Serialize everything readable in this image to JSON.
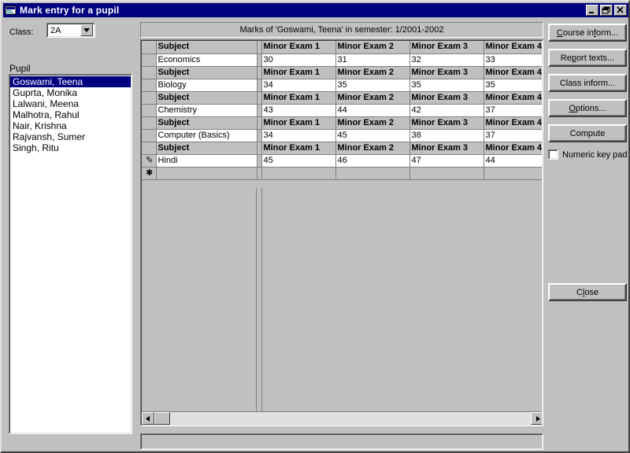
{
  "window": {
    "title": "Mark entry for a pupil",
    "icon": "app-window-icon",
    "minimize_label": "_",
    "restore_label": "❐",
    "close_label": "✕"
  },
  "left_panel": {
    "class_label": "Class:",
    "class_value": "2A",
    "pupil_label": "Pupil",
    "pupils": [
      {
        "name": "Goswami, Teena",
        "selected": true
      },
      {
        "name": "Guprta, Monika",
        "selected": false
      },
      {
        "name": "Lalwani, Meena",
        "selected": false
      },
      {
        "name": "Malhotra, Rahul",
        "selected": false
      },
      {
        "name": "Nair, Krishna",
        "selected": false
      },
      {
        "name": "Rajvansh, Sumer",
        "selected": false
      },
      {
        "name": "Singh, Ritu",
        "selected": false
      }
    ]
  },
  "grid": {
    "caption": "Marks of 'Goswami, Teena' in semester: 1/2001-2002",
    "headers": [
      "Subject",
      "Minor Exam 1",
      "Minor Exam 2",
      "Minor Exam 3",
      "Minor Exam 4"
    ],
    "row_marker_edit": "✎",
    "row_marker_new": "✱",
    "blocks": [
      {
        "header": [
          "Subject",
          "Minor Exam 1",
          "Minor Exam 2",
          "Minor Exam 3",
          "Minor Exam 4"
        ],
        "subject": "Economics",
        "marks": [
          "30",
          "31",
          "32",
          "33"
        ],
        "marker": ""
      },
      {
        "header": [
          "Subject",
          "Minor Exam 1",
          "Minor Exam 2",
          "Minor Exam 3",
          "Minor Exam 4"
        ],
        "subject": "Biology",
        "marks": [
          "34",
          "35",
          "35",
          "35"
        ],
        "marker": ""
      },
      {
        "header": [
          "Subject",
          "Minor Exam 1",
          "Minor Exam 2",
          "Minor Exam 3",
          "Minor Exam 4"
        ],
        "subject": "Chemistry",
        "marks": [
          "43",
          "44",
          "42",
          "37"
        ],
        "marker": ""
      },
      {
        "header": [
          "Subject",
          "Minor Exam 1",
          "Minor Exam 2",
          "Minor Exam 3",
          "Minor Exam 4"
        ],
        "subject": "Computer (Basics)",
        "marks": [
          "34",
          "45",
          "38",
          "37"
        ],
        "marker": ""
      },
      {
        "header": [
          "Subject",
          "Minor Exam 1",
          "Minor Exam 2",
          "Minor Exam 3",
          "Minor Exam 4"
        ],
        "subject": "Hindi",
        "marks": [
          "45",
          "46",
          "47",
          "44"
        ],
        "marker": "✎"
      }
    ],
    "scrollbar": {
      "left_arrow": "◄",
      "right_arrow": "►"
    }
  },
  "buttons": {
    "course_inform": {
      "pre": "C",
      "accel": "",
      "text": "Course inform...",
      "a": "C",
      "b": "ourse in",
      "c": "f",
      "d": "orm..."
    },
    "report_texts": {
      "a": "",
      "b": "Re",
      "c": "p",
      "d": "ort texts..."
    },
    "class_inform": {
      "a": "",
      "b": "Class inform...",
      "c": "",
      "d": ""
    },
    "options": {
      "a": "",
      "b": "",
      "c": "O",
      "d": "ptions..."
    },
    "compute": {
      "a": "",
      "b": "Compute",
      "c": "",
      "d": ""
    },
    "close": {
      "a": "",
      "b": "C",
      "c": "l",
      "d": "ose"
    },
    "numeric_keypad": {
      "label": "Numeric key pad",
      "checked": false
    }
  },
  "statusbar": {
    "text": ""
  },
  "colors": {
    "face": "#c0c0c0",
    "titlebar": "#000080",
    "selection": "#000080",
    "window": "#ffffff",
    "shadow": "#808080"
  }
}
